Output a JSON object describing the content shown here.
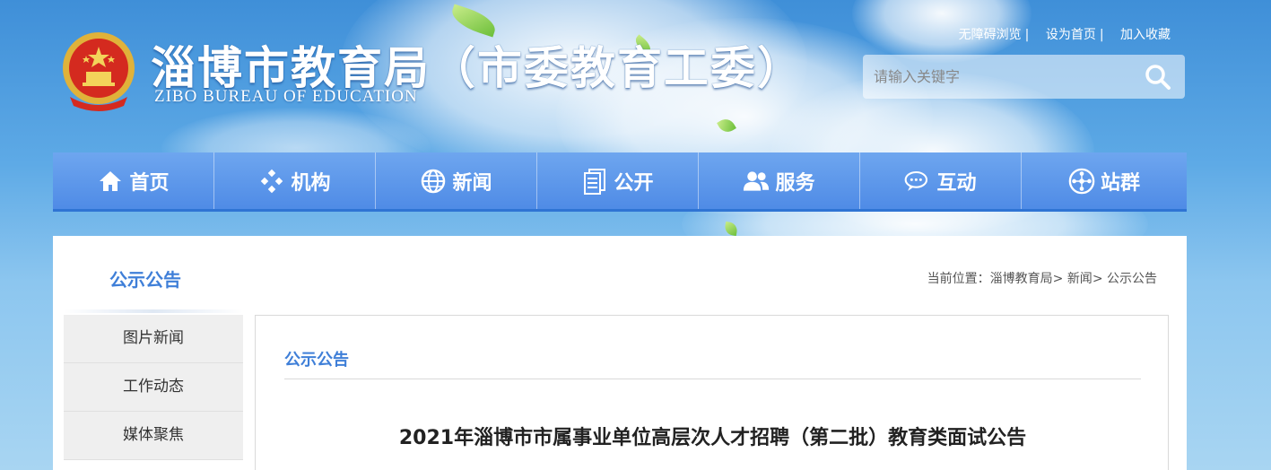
{
  "header": {
    "title_cn": "淄博市教育局（市委教育工委）",
    "title_en": "ZIBO BUREAU OF EDUCATION",
    "top_links": [
      "无障碍浏览",
      "设为首页",
      "加入收藏"
    ],
    "top_link_separator": "|"
  },
  "search": {
    "placeholder": "请输入关键字",
    "button_icon": "search-icon"
  },
  "nav": {
    "items": [
      {
        "label": "首页",
        "icon": "home-icon"
      },
      {
        "label": "机构",
        "icon": "diamond-cluster-icon"
      },
      {
        "label": "新闻",
        "icon": "globe-icon"
      },
      {
        "label": "公开",
        "icon": "documents-icon"
      },
      {
        "label": "服务",
        "icon": "users-icon"
      },
      {
        "label": "互动",
        "icon": "chat-icon"
      },
      {
        "label": "站群",
        "icon": "network-icon"
      }
    ]
  },
  "sidebar": {
    "title": "公示公告",
    "items": [
      "图片新闻",
      "工作动态",
      "媒体聚焦"
    ]
  },
  "breadcrumb": {
    "prefix": "当前位置：",
    "items": [
      "淄博教育局",
      "新闻",
      "公示公告"
    ],
    "separator": ">"
  },
  "main": {
    "heading": "公示公告",
    "article_title": "2021年淄博市市属事业单位高层次人才招聘（第二批）教育类面试公告"
  },
  "colors": {
    "accent": "#3f7fd8",
    "nav_bg": "#5a95ea",
    "sky": "#5eaae6"
  }
}
